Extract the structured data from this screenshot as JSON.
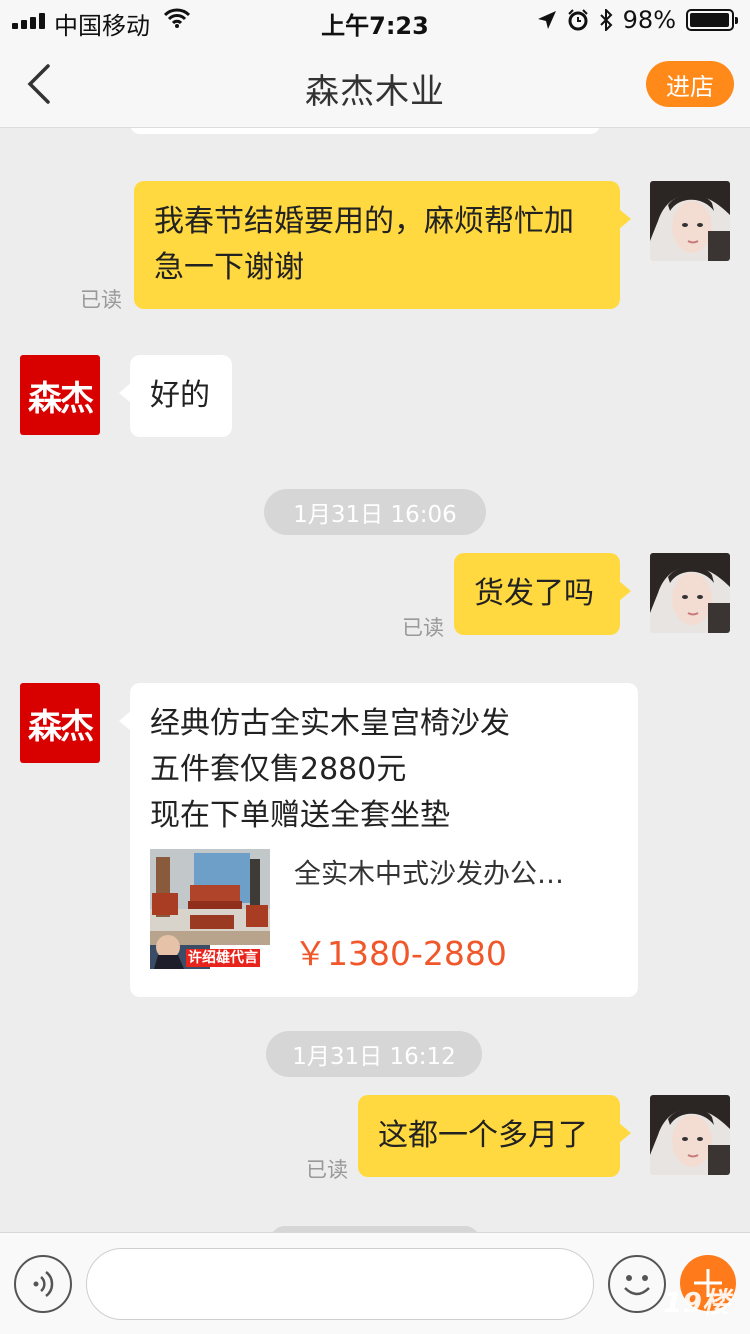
{
  "status_bar": {
    "carrier": "中国移动",
    "time": "上午7:23",
    "battery": "98%",
    "battery_level": 0.98
  },
  "nav": {
    "title": "森杰木业",
    "enter_shop_label": "进店"
  },
  "shop_avatar_text": "森杰",
  "messages": {
    "m1": {
      "text": "我春节结婚要用的，麻烦帮忙加急一下谢谢",
      "read": "已读"
    },
    "m2": {
      "text": "好的"
    },
    "t1": "1月31日 16:06",
    "m3": {
      "text": "货发了吗",
      "read": "已读"
    },
    "m4": {
      "lines": [
        "经典仿古全实木皇宫椅沙发",
        "五件套仅售2880元",
        "现在下单赠送全套坐垫"
      ],
      "product_name": "全实木中式沙发办公…",
      "product_price": "￥1380-2880",
      "product_badge": "许绍雄代言"
    },
    "t2": "1月31日 16:12",
    "m5": {
      "text": "这都一个多月了",
      "read": "已读"
    }
  },
  "input": {
    "value": "",
    "placeholder": "",
    "watermark": "19楼"
  },
  "icons": [
    "signal-icon",
    "wifi-icon",
    "location-icon",
    "alarm-icon",
    "bluetooth-icon",
    "battery-icon",
    "back-icon",
    "voice-icon",
    "emoji-icon",
    "plus-icon"
  ],
  "colors": {
    "accent": "#ff8a1a",
    "my_bubble": "#ffd93f",
    "price": "#f0582b",
    "shop_avatar": "#d90000"
  }
}
